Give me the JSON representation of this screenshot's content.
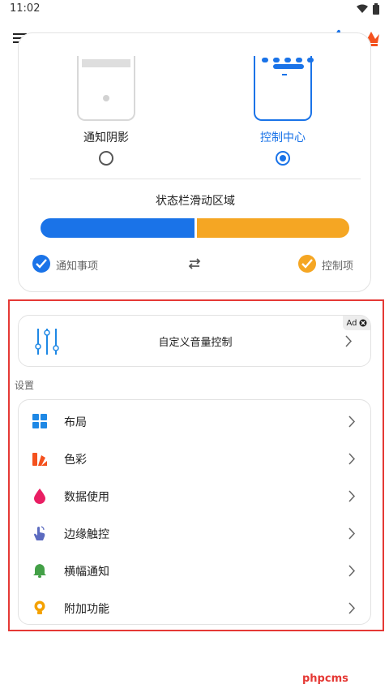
{
  "status_bar": {
    "time": "11:02"
  },
  "mode_selector": {
    "options": [
      {
        "label": "通知阴影",
        "selected": false
      },
      {
        "label": "控制中心",
        "selected": true
      }
    ],
    "area_title": "状态栏滑动区域",
    "split_fraction": 0.5,
    "left_label": "通知事项",
    "right_label": "控制项",
    "colors": {
      "primary": "#1a73e8",
      "secondary": "#f5a623"
    }
  },
  "ad": {
    "title": "自定义音量控制",
    "badge": "Ad"
  },
  "settings": {
    "section_title": "设置",
    "items": [
      {
        "label": "布局",
        "icon": "layout-grid-icon",
        "color": "#1e88e5"
      },
      {
        "label": "色彩",
        "icon": "palette-icon",
        "color": "#f4511e"
      },
      {
        "label": "数据使用",
        "icon": "data-drop-icon",
        "color": "#e91e63"
      },
      {
        "label": "边缘触控",
        "icon": "edge-touch-icon",
        "color": "#5c6bc0"
      },
      {
        "label": "横幅通知",
        "icon": "bell-icon",
        "color": "#43a047"
      },
      {
        "label": "附加功能",
        "icon": "bulb-icon",
        "color": "#f4a100"
      }
    ]
  },
  "watermark": "phpcms"
}
